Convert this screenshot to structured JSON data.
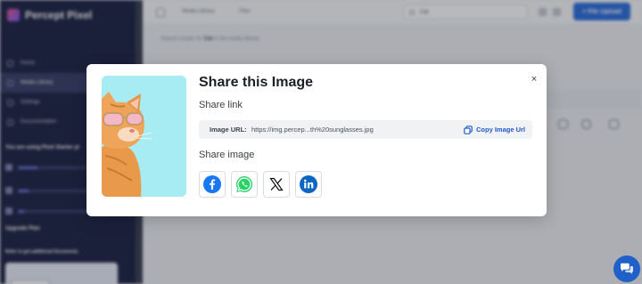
{
  "app": {
    "brand_name": "Percept Pixel",
    "nav_items": [
      {
        "label": "Home",
        "icon": "home-icon"
      },
      {
        "label": "Media Library",
        "icon": "library-icon",
        "active": true
      },
      {
        "label": "Settings",
        "icon": "gear-icon"
      },
      {
        "label": "Documentation",
        "icon": "document-icon"
      }
    ],
    "usage_title": "You are using Pixel Starter pl",
    "upgrade_label": "Upgrade Plan",
    "refer_text": "Refer to get additional Documents",
    "breadcrumbs": [
      "Media Library",
      "Files"
    ],
    "search_value": "Cat",
    "upload_label": "+ File Upload",
    "results_prefix": "Search results for ",
    "results_query": "Cat",
    "results_suffix": " in the media library"
  },
  "modal": {
    "title": "Share this Image",
    "share_link_label": "Share link",
    "url_label": "Image URL:",
    "url_value": "https://img.percep...th%20sunglasses.jpg",
    "copy_label": "Copy Image Url",
    "share_image_label": "Share image",
    "close_glyph": "×",
    "share_targets": [
      "facebook-icon",
      "whatsapp-icon",
      "x-icon",
      "linkedin-icon"
    ]
  },
  "colors": {
    "accent": "#2358c9",
    "sidebar_bg": "#1f2547",
    "thumb_bg": "#a7ecf3",
    "facebook": "#1877f2",
    "whatsapp": "#25d366",
    "linkedin": "#0a66c2",
    "chat": "#1f61c8"
  }
}
